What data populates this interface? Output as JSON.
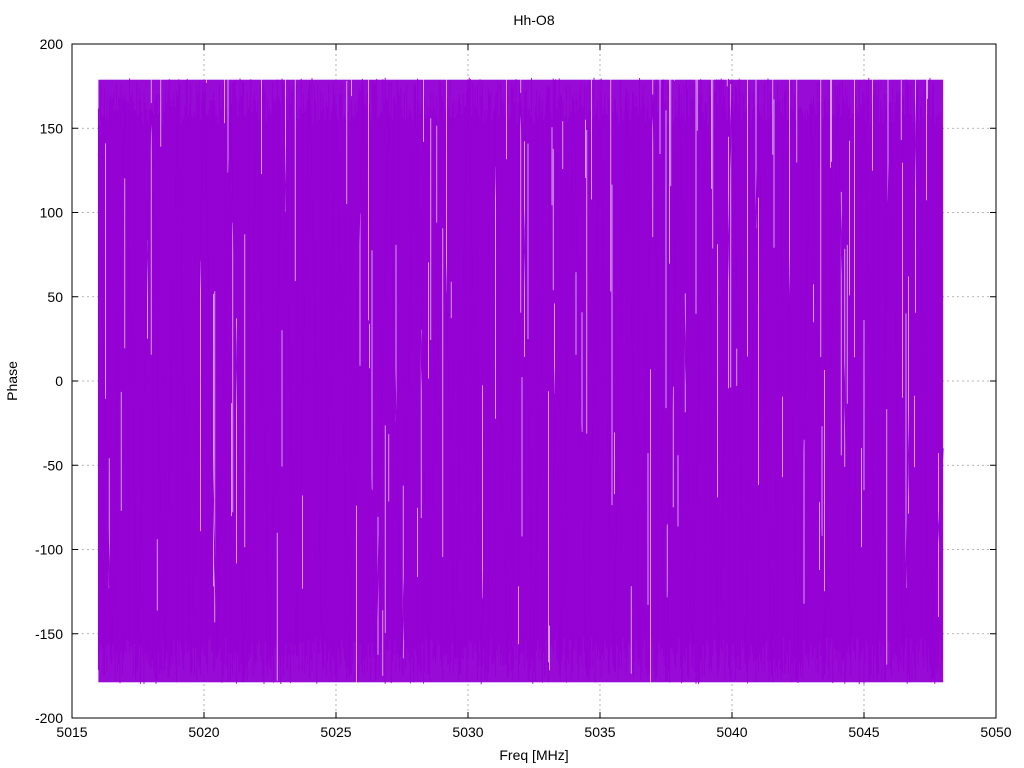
{
  "chart_data": {
    "type": "line",
    "title": "Hh-O8",
    "xlabel": "Freq [MHz]",
    "ylabel": "Phase",
    "xlim": [
      5015,
      5050
    ],
    "ylim": [
      -200,
      200
    ],
    "xticks": [
      5015,
      5020,
      5025,
      5030,
      5035,
      5040,
      5045,
      5050
    ],
    "yticks": [
      -200,
      -150,
      -100,
      -50,
      0,
      50,
      100,
      150,
      200
    ],
    "grid": true,
    "legend": "none",
    "series": [
      {
        "color": "#9400d3",
        "x_start": 5016.0,
        "x_end": 5048.0,
        "y_min": -180,
        "y_max": 180,
        "x": [
          5016.0,
          5016.5,
          5017.0,
          5017.5,
          5018.0,
          5018.5,
          5019.0,
          5019.5,
          5020.0,
          5020.5,
          5021.0,
          5021.5,
          5022.0,
          5022.5,
          5023.0,
          5023.5,
          5024.0,
          5024.5,
          5025.0,
          5025.5,
          5026.0,
          5026.5,
          5027.0,
          5027.5,
          5028.0,
          5028.5,
          5029.0,
          5029.5,
          5030.0,
          5030.5,
          5031.0,
          5031.5,
          5032.0,
          5032.5,
          5033.0,
          5033.5,
          5034.0,
          5034.5,
          5035.0,
          5035.5,
          5036.0,
          5036.5,
          5037.0,
          5037.5,
          5038.0,
          5038.5,
          5039.0,
          5039.5,
          5040.0,
          5040.5,
          5041.0,
          5041.5,
          5042.0,
          5042.5,
          5043.0,
          5043.5,
          5044.0,
          5044.5,
          5045.0,
          5045.5,
          5046.0,
          5046.5,
          5047.0,
          5047.5,
          5048.0
        ],
        "y": [
          135,
          -168,
          170,
          -160,
          165,
          -172,
          158,
          -175,
          172,
          -165,
          168,
          -178,
          160,
          -170,
          175,
          -162,
          178,
          -172,
          165,
          -176,
          170,
          -178,
          162,
          -168,
          176,
          -174,
          169,
          -165,
          178,
          -170,
          162,
          -176,
          171,
          -163,
          175,
          -172,
          168,
          -175,
          160,
          -168,
          174,
          -165,
          170,
          -178,
          176,
          -170,
          165,
          -172,
          178,
          -168,
          160,
          -175,
          172,
          -170,
          168,
          -174,
          175,
          -162,
          170,
          -178,
          166,
          -172,
          174,
          -170,
          -40
        ]
      }
    ]
  }
}
